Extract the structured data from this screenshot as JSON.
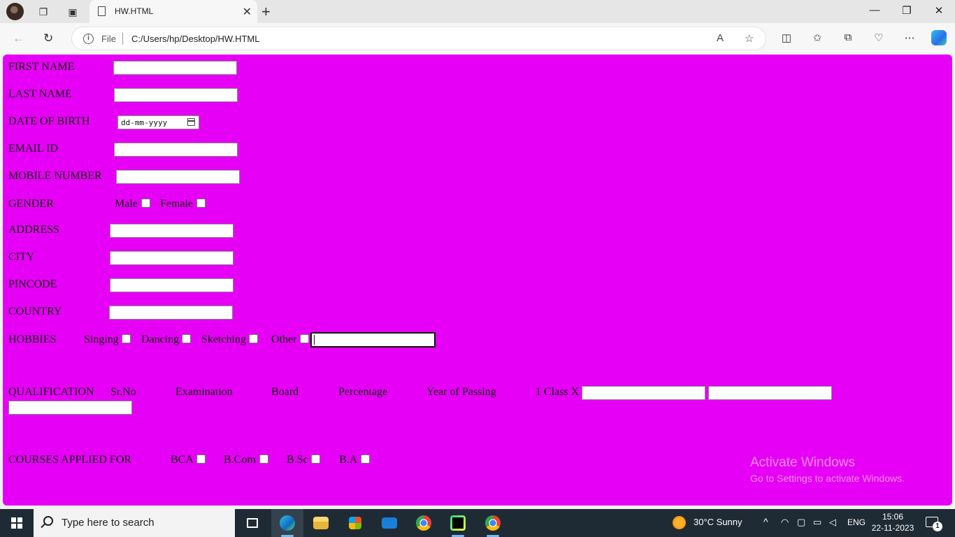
{
  "browser": {
    "tab_title": "HW.HTML",
    "address_prefix": "File",
    "address_url": "C:/Users/hp/Desktop/HW.HTML"
  },
  "form": {
    "first_name_label": "FIRST NAME",
    "last_name_label": "LAST NAME",
    "dob_label": "DATE OF BIRTH",
    "dob_placeholder": "dd-mm-yyyy",
    "email_label": "EMAIL ID",
    "mobile_label": "MOBILE NUMBER",
    "gender_label": "GENDER",
    "gender_options": [
      "Male",
      "Female"
    ],
    "address_label": "ADDRESS",
    "city_label": "CITY",
    "pincode_label": "PINCODE",
    "country_label": "COUNTRY",
    "hobbies_label": "HOBBIES",
    "hobby_options": [
      "Singing",
      "Dancing",
      "Sketching",
      "Other"
    ],
    "qualification_label": "QUALIFICATION",
    "qualification_headers": [
      "Sr.No",
      "Examination",
      "Board",
      "Percentage",
      "Year of Passing"
    ],
    "qualification_row_label": "1 Class X",
    "courses_label": "COURSES APPLIED FOR",
    "course_options": [
      "BCA",
      "B.Com",
      "B.Sc",
      "B.A"
    ]
  },
  "watermark": {
    "line1": "Activate Windows",
    "line2": "Go to Settings to activate Windows."
  },
  "taskbar": {
    "search_placeholder": "Type here to search",
    "weather": "30°C  Sunny",
    "language": "ENG",
    "time": "15:06",
    "date": "22-11-2023",
    "notification_count": "1"
  }
}
